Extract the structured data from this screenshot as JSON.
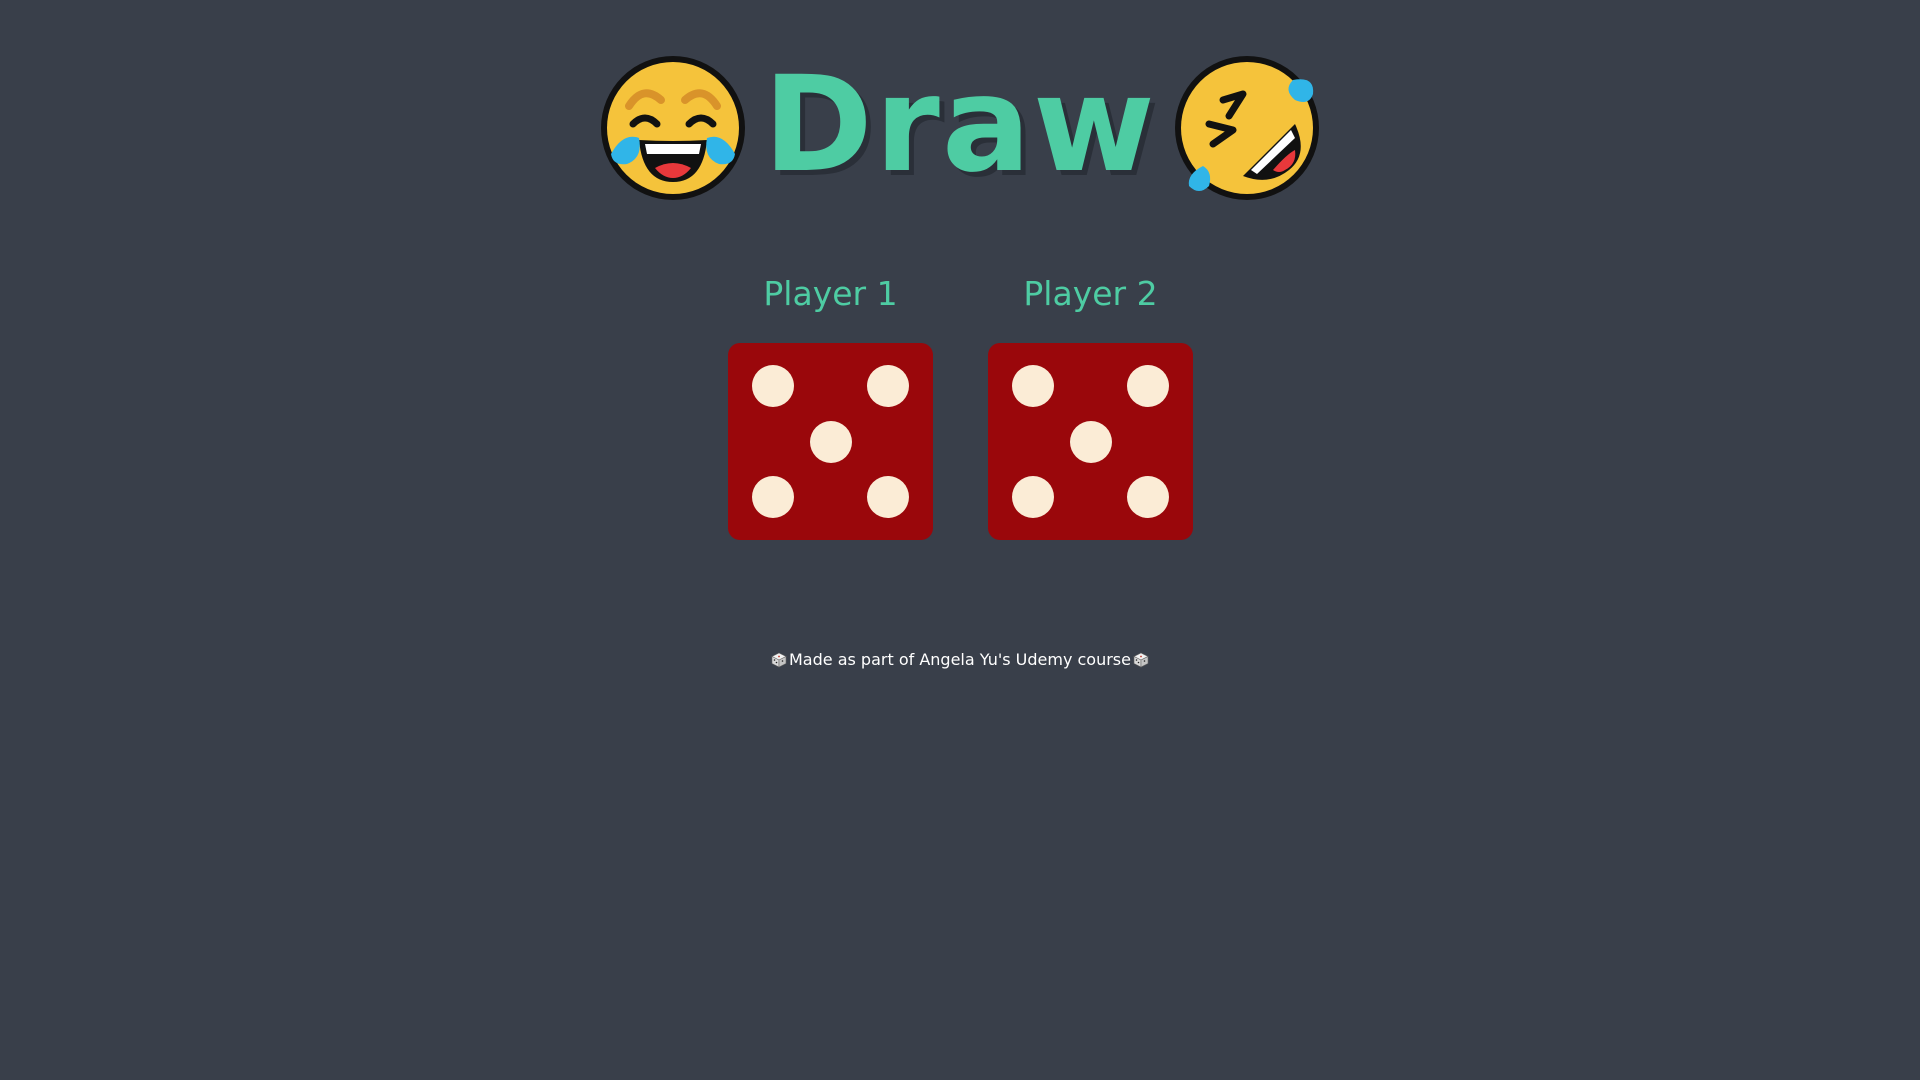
{
  "title": {
    "text": "Draw",
    "left_icon": "tears-of-joy-emoji-icon",
    "right_icon": "rolling-on-floor-laughing-emoji-icon"
  },
  "players": [
    {
      "label": "Player 1",
      "die_value": 5
    },
    {
      "label": "Player 2",
      "die_value": 5
    }
  ],
  "footer": {
    "text": "Made as part of Angela Yu's Udemy course",
    "icon": "game-die-icon"
  },
  "colors": {
    "background": "#393f4a",
    "title": "#4ecca3",
    "die": "#9a070b",
    "pip": "#fbecd6",
    "footer_text": "#ffffff"
  }
}
